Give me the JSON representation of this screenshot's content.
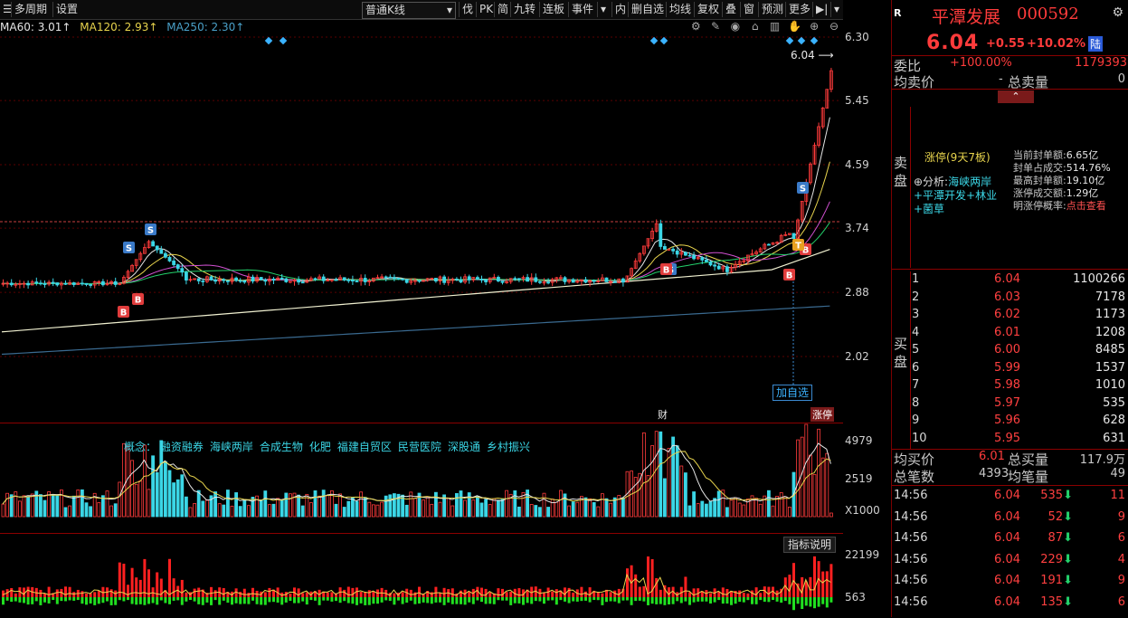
{
  "toolbar": {
    "left_label": "R",
    "period": "多周期",
    "settings": "设置",
    "kline_mode": "普通K线",
    "buttons": [
      "伐",
      "PK",
      "简",
      "九转",
      "连板",
      "事件"
    ],
    "right_buttons": [
      "内",
      "删自选",
      "均线",
      "复权",
      "叠",
      "窗",
      "预测",
      "更多"
    ]
  },
  "ma_legend": [
    {
      "label": "MA60: 3.01↑",
      "color": "#e6e6e6"
    },
    {
      "label": "MA120: 2.93↑",
      "color": "#e8d44d"
    },
    {
      "label": "MA250: 2.30↑",
      "color": "#4aa0c8"
    }
  ],
  "price_axis": [
    "6.30",
    "5.45",
    "4.59",
    "3.74",
    "2.88",
    "2.02"
  ],
  "vol_axis": [
    "4979",
    "2519",
    "X1000"
  ],
  "ind_axis": [
    "22199",
    "563"
  ],
  "annotations": {
    "last_price": "6.04",
    "add_watch": "加自选",
    "cai": "财",
    "limit": "涨停",
    "concept_title": "概念：",
    "concepts": [
      "融资融券",
      "海峡两岸",
      "合成生物",
      "化肥",
      "福建自贸区",
      "民营医院",
      "深股通",
      "乡村振兴"
    ],
    "indicator_help": "指标说明",
    "zhangting_title": "涨停(9天7板)",
    "analysis_label": "⊕分析:",
    "analysis_text": "海峡两岸+平潭开发+林业+菌草",
    "stats": [
      {
        "k": "当前封单额:",
        "v": "6.65亿"
      },
      {
        "k": "封单占成交:",
        "v": "514.76%"
      },
      {
        "k": "最高封单额:",
        "v": "19.10亿"
      },
      {
        "k": "涨停成交额:",
        "v": "1.29亿"
      },
      {
        "k": "明涨停概率:",
        "v": "点击查看"
      }
    ]
  },
  "stock": {
    "name": "平潭发展",
    "code": "000592",
    "price": "6.04",
    "change": "+0.55",
    "change_pct": "+10.02%",
    "tag": "陆"
  },
  "summary": {
    "weibi_label": "委比",
    "weibi": "+100.00%",
    "weicha": "1179393",
    "avg_sell_label": "均卖价",
    "avg_sell": "-",
    "total_sell_label": "总卖量",
    "total_sell": "0",
    "sell_side": "卖盘",
    "buy_side": "买盘",
    "avg_buy_label": "均买价",
    "avg_buy": "6.01",
    "total_buy_label": "总买量",
    "total_buy": "117.9万",
    "total_orders_label": "总笔数",
    "total_orders": "4393",
    "avg_orders_label": "均笔量",
    "avg_orders": "49"
  },
  "bids": [
    {
      "lv": "1",
      "p": "6.04",
      "v": "1100266"
    },
    {
      "lv": "2",
      "p": "6.03",
      "v": "7178"
    },
    {
      "lv": "3",
      "p": "6.02",
      "v": "1173"
    },
    {
      "lv": "4",
      "p": "6.01",
      "v": "1208"
    },
    {
      "lv": "5",
      "p": "6.00",
      "v": "8485"
    },
    {
      "lv": "6",
      "p": "5.99",
      "v": "1537"
    },
    {
      "lv": "7",
      "p": "5.98",
      "v": "1010"
    },
    {
      "lv": "8",
      "p": "5.97",
      "v": "535"
    },
    {
      "lv": "9",
      "p": "5.96",
      "v": "628"
    },
    {
      "lv": "10",
      "p": "5.95",
      "v": "631"
    }
  ],
  "ticks": [
    {
      "t": "14:56",
      "p": "6.04",
      "v": "535",
      "n": "11"
    },
    {
      "t": "14:56",
      "p": "6.04",
      "v": "52",
      "n": "9"
    },
    {
      "t": "14:56",
      "p": "6.04",
      "v": "87",
      "n": "6"
    },
    {
      "t": "14:56",
      "p": "6.04",
      "v": "229",
      "n": "4"
    },
    {
      "t": "14:56",
      "p": "6.04",
      "v": "191",
      "n": "9"
    },
    {
      "t": "14:56",
      "p": "6.04",
      "v": "135",
      "n": "6"
    }
  ]
}
